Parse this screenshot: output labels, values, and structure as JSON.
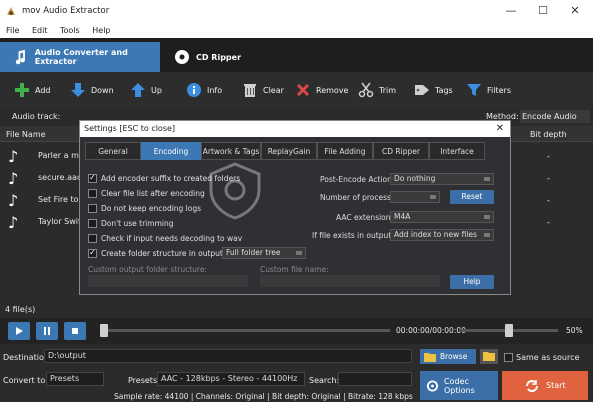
{
  "window": {
    "title": "mov Audio Extractor",
    "minimize": "—",
    "maximize": "☐",
    "close": "✕"
  },
  "menu": [
    "File",
    "Edit",
    "Tools",
    "Help"
  ],
  "main_tabs": [
    {
      "label": "Audio Converter and Extractor",
      "active": true
    },
    {
      "label": "CD Ripper",
      "active": false
    }
  ],
  "toolbar": [
    {
      "label": "Add",
      "icon": "plus-icon",
      "color": "#3fb24a"
    },
    {
      "label": "Down",
      "icon": "arrow-down-icon",
      "color": "#3c8ee0"
    },
    {
      "label": "Up",
      "icon": "arrow-up-icon",
      "color": "#3c8ee0"
    },
    {
      "label": "Info",
      "icon": "info-icon",
      "color": "#3c8ee0"
    },
    {
      "label": "Clear",
      "icon": "trash-icon",
      "color": "#d0d0d0"
    },
    {
      "label": "Remove",
      "icon": "x-icon",
      "color": "#e04848"
    },
    {
      "label": "Trim",
      "icon": "scissors-icon",
      "color": "#d0d0d0"
    },
    {
      "label": "Tags",
      "icon": "tag-icon",
      "color": "#d0d0d0"
    },
    {
      "label": "Filters",
      "icon": "filter-icon",
      "color": "#3c8ee0"
    }
  ],
  "audio_track_label": "Audio track:",
  "method_label": "Method:",
  "method_value": "Encode Audio",
  "columns": {
    "file_name": "File Name",
    "bit_depth": "Bit depth"
  },
  "files": [
    {
      "name": "Parler a mo",
      "bit_depth": "-"
    },
    {
      "name": "secure.aac",
      "bit_depth": "-"
    },
    {
      "name": "Set Fire to t",
      "bit_depth": "-"
    },
    {
      "name": "Taylor Swift",
      "bit_depth": "-"
    }
  ],
  "file_count": "4 file(s)",
  "player": {
    "time": "00:00:00/00:00:00",
    "volume": "50%",
    "progress": 0.0,
    "volume_level": 0.5
  },
  "destination": {
    "label": "Destination:",
    "value": "D:\\output",
    "browse": "Browse",
    "same_as_source": "Same as source"
  },
  "convert": {
    "label": "Convert to:",
    "value": "Presets",
    "presets_label": "Presets:",
    "presets_value": "AAC - 128kbps - Stereo - 44100Hz",
    "search_label": "Search:"
  },
  "codec_button": "Codec Options",
  "start_button": "Start",
  "status": "Sample rate: 44100 | Channels: Original | Bit depth: Original | Bitrate: 128 kbps",
  "dialog": {
    "title": "Settings [ESC to close]",
    "close": "✕",
    "tabs": [
      "General",
      "Encoding",
      "Artwork & Tags",
      "ReplayGain",
      "File Adding",
      "CD Ripper",
      "Interface"
    ],
    "active_tab": "Encoding",
    "options": [
      {
        "label": "Add encoder suffix to created folders",
        "checked": true
      },
      {
        "label": "Clear file list after encoding",
        "checked": false
      },
      {
        "label": "Do not keep encoding logs",
        "checked": false
      },
      {
        "label": "Don't use trimming",
        "checked": false
      },
      {
        "label": "Check if input needs decoding to wav",
        "checked": false
      },
      {
        "label": "Create folder structure in output",
        "checked": true
      }
    ],
    "folder_tree_value": "Full folder tree",
    "custom_output_label": "Custom output folder structure:",
    "custom_file_label": "Custom file name:",
    "post_encode_label": "Post-Encode Action:",
    "post_encode_value": "Do nothing",
    "processes_label": "Number of processes:",
    "reset_button": "Reset",
    "aac_ext_label": "AAC extension:",
    "aac_ext_value": "M4A",
    "if_exists_label": "If file exists in output:",
    "if_exists_value": "Add index to new files",
    "help_button": "Help"
  },
  "colors": {
    "accent": "#3c78b4",
    "start": "#e0623e",
    "titlebar": "#ffffff"
  }
}
